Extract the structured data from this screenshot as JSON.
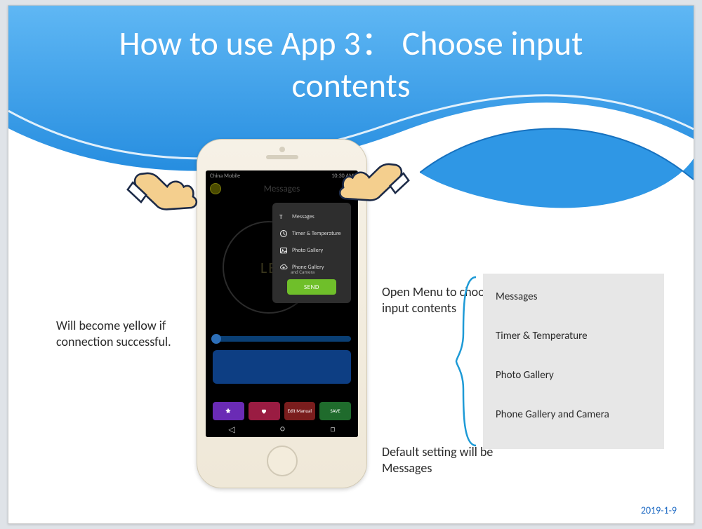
{
  "title_line1": "How to use App 3：  Choose input",
  "title_line2": "contents",
  "caption_left": "Will become yellow if connection successful.",
  "caption_mid": "Open Menu to choose input contents",
  "caption_default": "Default setting will be Messages",
  "options": {
    "o1": "Messages",
    "o2": "Timer & Temperature",
    "o3": "Photo Gallery",
    "o4": "Phone Gallery and Camera"
  },
  "phone": {
    "statusbar_left": "China Mobile",
    "statusbar_right": "10:30 AM",
    "header": "Messages",
    "ring_text": "LE",
    "menu": {
      "m1": "Messages",
      "m2": "Timer & Temperature",
      "m3": "Photo Gallery",
      "m4a": "Phone Gallery",
      "m4b": "and Camera",
      "send": "SEND"
    },
    "btn3": "Edit Manual",
    "btn4": "SAVE"
  },
  "date": "2019-1-9"
}
